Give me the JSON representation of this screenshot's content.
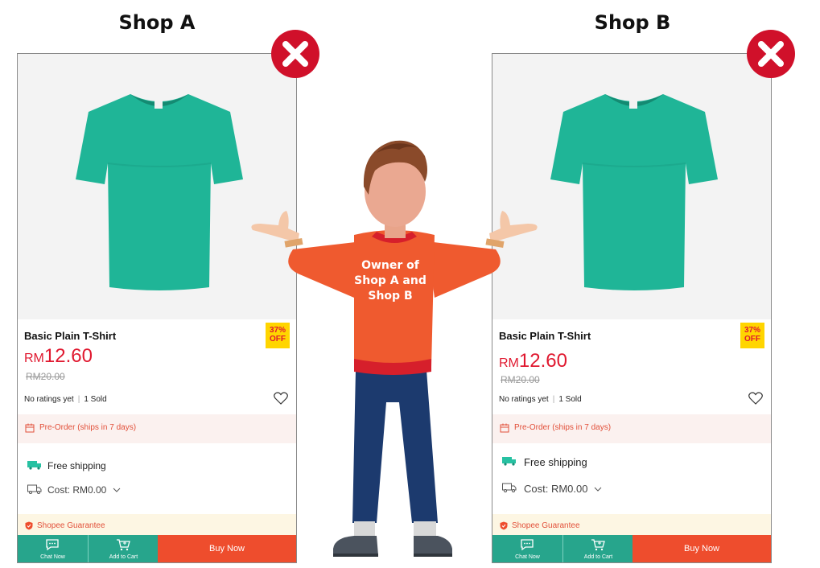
{
  "shops": [
    {
      "title": "Shop A",
      "product": {
        "name": "Basic Plain T-Shirt",
        "currency": "RM",
        "price": "12.60",
        "old_price": "RM20.00",
        "discount_pct": "37%",
        "discount_label": "OFF",
        "ratings": "No ratings yet",
        "sold": "1 Sold",
        "preorder": "Pre-Order (ships in 7 days)",
        "shipping": "Free shipping",
        "cost": "Cost: RM0.00",
        "guarantee": "Shopee Guarantee"
      },
      "bottom_bar": {
        "chat": "Chat Now",
        "cart": "Add to Cart",
        "buy": "Buy Now"
      }
    },
    {
      "title": "Shop B",
      "product": {
        "name": "Basic Plain T-Shirt",
        "currency": "RM",
        "price": "12.60",
        "old_price": "RM20.00",
        "discount_pct": "37%",
        "discount_label": "OFF",
        "ratings": "No ratings yet",
        "sold": "1 Sold",
        "preorder": "Pre-Order (ships in 7 days)",
        "shipping": "Free shipping",
        "cost": "Cost: RM0.00",
        "guarantee": "Shopee Guarantee"
      },
      "bottom_bar": {
        "chat": "Chat Now",
        "cart": "Add to Cart",
        "buy": "Buy Now"
      }
    }
  ],
  "owner": {
    "lines": [
      "Owner of",
      "Shop A and",
      "Shop B"
    ]
  },
  "icons": [
    "close-icon",
    "heart-icon",
    "calendar-icon",
    "free-shipping-icon",
    "truck-icon",
    "chevron-down-icon",
    "shield-icon",
    "chat-icon",
    "cart-icon"
  ],
  "colors": {
    "price_red": "#e0182f",
    "shopee_orange": "#ee4d2d",
    "teal": "#27a58c",
    "tshirt": "#1fb597",
    "x_badge_red": "#d0102a",
    "sweater_orange": "#ef5a2f",
    "jeans_blue": "#1c3a6e"
  }
}
